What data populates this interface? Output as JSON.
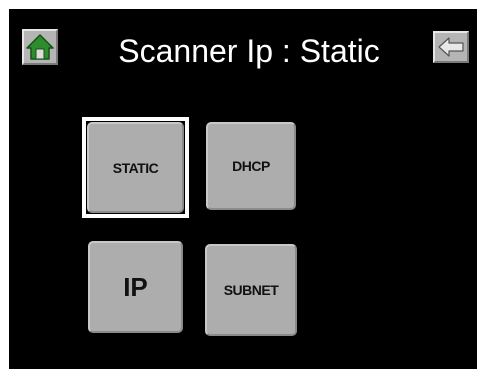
{
  "header": {
    "title": "Scanner Ip : Static",
    "home_icon": "home-icon",
    "back_icon": "back-arrow-icon"
  },
  "buttons": {
    "static": "STATIC",
    "dhcp": "DHCP",
    "ip": "IP",
    "subnet": "SUBNET"
  },
  "colors": {
    "background": "#000000",
    "tile": "#adadad",
    "selected_outline": "#ffffff",
    "home_icon_green": "#2e8b2e"
  }
}
